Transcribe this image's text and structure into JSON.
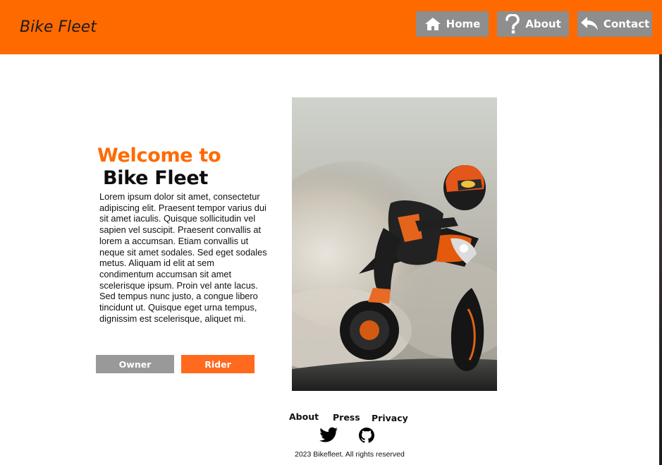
{
  "header": {
    "brand": "Bike Fleet",
    "nav": [
      {
        "label": "Home",
        "icon": "home-icon"
      },
      {
        "label": "About",
        "icon": "question-icon"
      },
      {
        "label": "Contact",
        "icon": "reply-arrow-icon"
      }
    ]
  },
  "hero": {
    "title_line1": "Welcome to",
    "title_line2": "Bike Fleet",
    "body": " Lorem ipsum dolor sit amet, consectetur adipiscing elit. Praesent tempor varius dui sit amet iaculis. Quisque sollicitudin vel sapien vel suscipit. Praesent convallis at lorem a accumsan. Etiam convallis ut neque sit amet sodales. Sed eget sodales metus. Aliquam id elit at sem condimentum accumsan sit amet scelerisque ipsum. Proin vel ante lacus. Sed tempus nunc justo, a congue libero tincidunt ut. Quisque eget urna tempus, dignissim est scelerisque, aliquet mi.",
    "buttons": {
      "owner": "Owner",
      "rider": "Rider"
    },
    "image": "motorcycle-rider-photo"
  },
  "footer": {
    "links": {
      "about": "About",
      "press": "Press",
      "privacy": "Privacy"
    },
    "social": [
      "twitter-icon",
      "github-icon"
    ],
    "copyright": "2023 Bikefleet. All rights reserved"
  },
  "colors": {
    "brand_orange": "#ff6a00",
    "nav_button_gray": "#8e8e8e",
    "owner_button_gray": "#9a9999",
    "rider_button_orange": "#ff6a1f"
  }
}
